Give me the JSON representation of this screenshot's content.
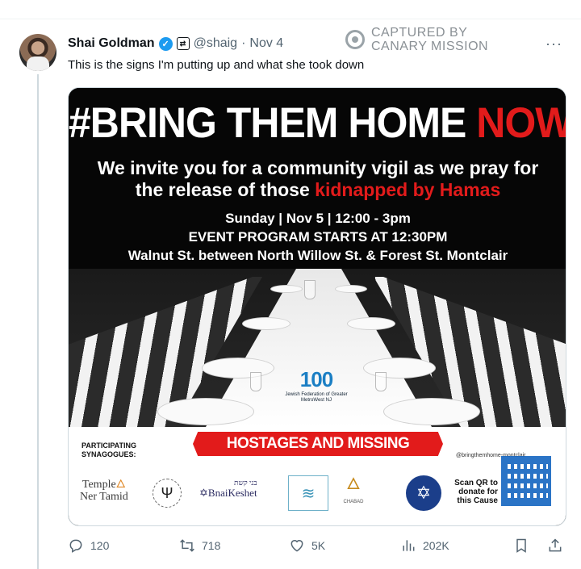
{
  "tweet": {
    "author_name": "Shai Goldman",
    "handle": "@shaig",
    "separator": "·",
    "date": "Nov 4",
    "text": "This is the signs I'm putting up and what she took down",
    "more_label": "···"
  },
  "watermark": {
    "line1": "CAPTURED BY",
    "line2": "CANARY MISSION"
  },
  "poster": {
    "headline_white": "#BRING THEM HOME ",
    "headline_red": "NOW!",
    "invite_line1": "We invite you for a community vigil as we pray for",
    "invite_line2_white": "the release of those ",
    "invite_line2_red": "kidnapped by Hamas",
    "date_time": "Sunday | Nov 5 | 12:00 - 3pm",
    "program_start": "EVENT PROGRAM STARTS AT 12:30PM",
    "location": "Walnut St. between North Willow St. & Forest St. Montclair",
    "federation_number": "100",
    "federation_name": "Jewish Federation of Greater MetroWest NJ",
    "forum_banner": "HOSTAGES AND MISSING FAMILIES FORUM",
    "participating": "PARTICIPATING SYNAGOGUES:",
    "hashtag": "@bringthemhome-montclair",
    "temple_line1": "Temple",
    "temple_line2": "Ner Tamid",
    "braikeshet_hebrew": "בני קשת",
    "braikeshet": "BnaiKeshet",
    "chabad": "CHABAD",
    "scan_qr": "Scan QR to donate for this Cause"
  },
  "actions": {
    "replies": "120",
    "reposts": "718",
    "likes": "5K",
    "views": "202K"
  },
  "colors": {
    "accent_blue": "#1d9bf0",
    "poster_red": "#e21b1b",
    "muted": "#536471"
  }
}
